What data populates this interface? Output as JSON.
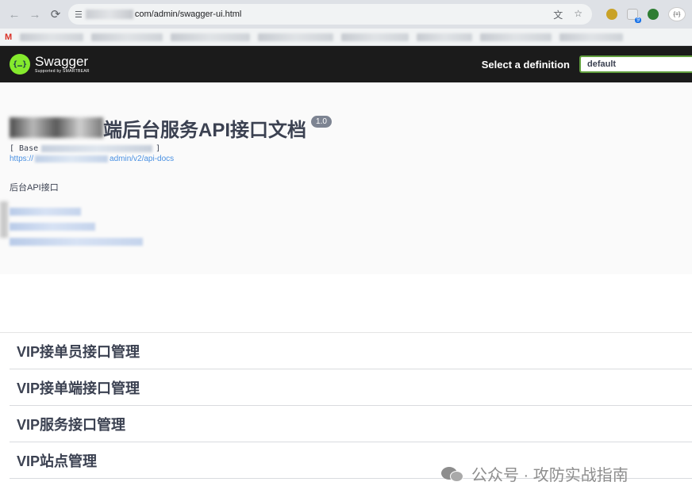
{
  "browser": {
    "url_suffix": "com/admin/swagger-ui.html",
    "bookmark_gmail_label": "M"
  },
  "topbar": {
    "logo_title": "Swagger",
    "logo_subtitle": "Supported by SMARTBEAR",
    "logo_mark": "{…}",
    "definition_label": "Select a definition",
    "definition_value": "default"
  },
  "info": {
    "title": "端后台服务API接口文档",
    "version": "1.0",
    "base_url_prefix": "[ Base",
    "base_url_suffix": "]",
    "api_docs_prefix": "https://",
    "api_docs_suffix": "admin/v2/api-docs",
    "description": "后台API接口"
  },
  "tags": [
    {
      "label": "VIP接单员接口管理"
    },
    {
      "label": "VIP接单端接口管理"
    },
    {
      "label": "VIP服务接口管理"
    },
    {
      "label": "VIP站点管理"
    }
  ],
  "watermark": {
    "text": "公众号 · 攻防实战指南"
  },
  "colors": {
    "topbar_bg": "#1b1b1b",
    "logo_green": "#85ea2d",
    "select_border": "#62a03f",
    "link_blue": "#4990e2",
    "text": "#3b4151"
  }
}
